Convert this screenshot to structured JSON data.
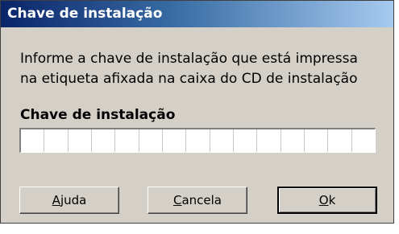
{
  "dialog": {
    "title": "Chave de instalação",
    "instruction_line1": "Informe a chave de instalação que está impressa",
    "instruction_line2": "na etiqueta afixada na caixa do CD de instalação",
    "field_label": "Chave de instalação",
    "key_value": "",
    "key_cell_count": 15
  },
  "buttons": {
    "help": {
      "accel": "A",
      "rest": "juda"
    },
    "cancel": {
      "accel": "C",
      "rest": "ancela"
    },
    "ok": {
      "accel": "O",
      "rest": "k"
    }
  },
  "colors": {
    "titlebar_start": "#0a246a",
    "titlebar_end": "#a6caf0",
    "dialog_face": "#d4d0c8"
  }
}
